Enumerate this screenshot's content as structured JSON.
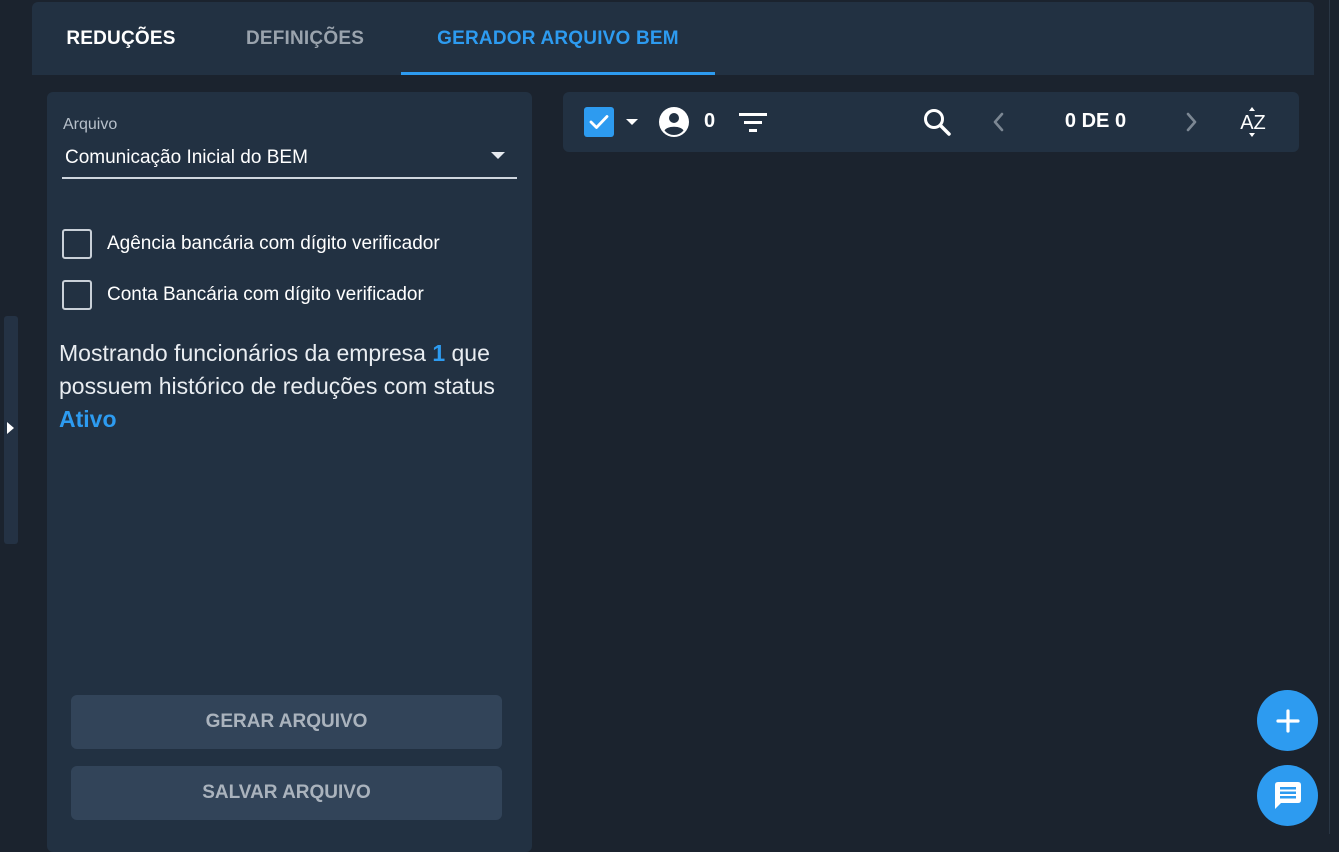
{
  "tabs": [
    {
      "label": "REDUÇÕES"
    },
    {
      "label": "DEFINIÇÕES"
    },
    {
      "label": "GERADOR ARQUIVO BEM"
    }
  ],
  "form": {
    "field_label": "Arquivo",
    "selected_file": "Comunicação Inicial do BEM",
    "checkbox_agencia": "Agência bancária com dígito verificador",
    "checkbox_conta": "Conta Bancária com dígito verificador",
    "agencia_checked": false,
    "conta_checked": false
  },
  "info": {
    "part1": "Mostrando funcionários da empresa ",
    "company": "1",
    "part2": " que possuem histórico de reduções com status ",
    "status": "Ativo"
  },
  "buttons": {
    "generate": "GERAR ARQUIVO",
    "save": "SALVAR ARQUIVO"
  },
  "toolbar": {
    "selected_count": "0",
    "pager": "0 DE 0",
    "sort_label": "AZ",
    "select_all_checked": true
  },
  "colors": {
    "accent": "#2d9bf0",
    "panel": "#223142",
    "background": "#1b232e"
  },
  "icons": {
    "check": "check-icon",
    "dropdown": "arrow-drop-down-icon",
    "account": "account-circle-icon",
    "filter": "filter-icon",
    "search": "search-icon",
    "prev": "chevron-left-icon",
    "next": "chevron-right-icon",
    "sort": "sort-alpha-icon",
    "add": "plus-icon",
    "chat": "chat-icon"
  }
}
